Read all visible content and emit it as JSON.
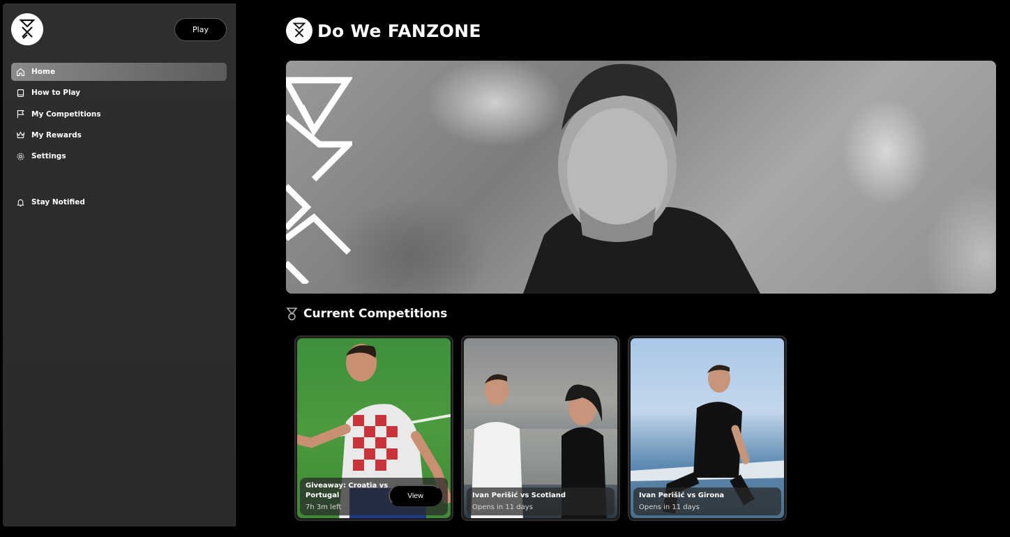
{
  "app": {
    "title": "Do We FANZONE"
  },
  "sidebar": {
    "play_label": "Play",
    "items": [
      {
        "label": "Home",
        "icon": "home-icon"
      },
      {
        "label": "How to Play",
        "icon": "book-icon"
      },
      {
        "label": "My Competitions",
        "icon": "flag-icon"
      },
      {
        "label": "My Rewards",
        "icon": "crown-icon"
      },
      {
        "label": "Settings",
        "icon": "gear-icon"
      }
    ],
    "notify_label": "Stay Notified"
  },
  "main": {
    "section_title": "Current Competitions",
    "cards": [
      {
        "title": "Giveaway: Croatia vs Portugal",
        "status": "7h 3m left",
        "action": "View"
      },
      {
        "title": "Ivan Perišić vs Scotland",
        "status": "Opens in 11 days"
      },
      {
        "title": "Ivan Perišić vs Girona",
        "status": "Opens in 11 days"
      }
    ]
  },
  "colors": {
    "active_nav": "#8a8a8a",
    "background": "#000000",
    "sidebar": "#2e2e2e"
  }
}
